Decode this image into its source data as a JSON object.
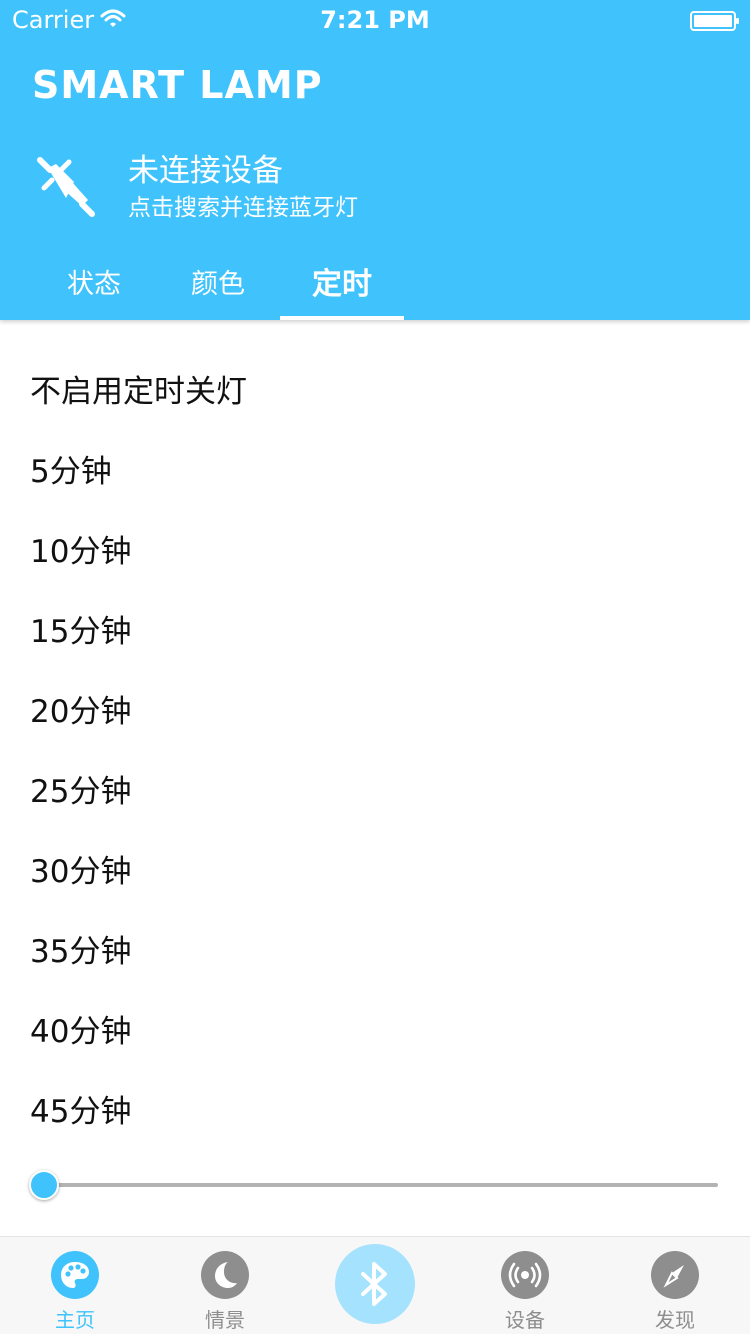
{
  "status_bar": {
    "carrier": "Carrier",
    "time": "7:21 PM",
    "wifi_icon": "wifi-icon",
    "battery_icon": "battery-icon"
  },
  "header": {
    "title": "SMART LAMP",
    "device_icon": "plug-icon",
    "connection_title": "未连接设备",
    "connection_subtitle": "点击搜索并连接蓝牙灯"
  },
  "tabs": [
    {
      "label": "状态",
      "active": false
    },
    {
      "label": "颜色",
      "active": false
    },
    {
      "label": "定时",
      "active": true
    }
  ],
  "timer_options": [
    "不启用定时关灯",
    "5分钟",
    "10分钟",
    "15分钟",
    "20分钟",
    "25分钟",
    "30分钟",
    "35分钟",
    "40分钟",
    "45分钟"
  ],
  "slider": {
    "value_fraction": 0.0
  },
  "bottom_nav": {
    "items": [
      {
        "label": "主页",
        "icon": "palette-icon",
        "active": true
      },
      {
        "label": "情景",
        "icon": "moon-icon",
        "active": false
      },
      {
        "label": "",
        "icon": "bluetooth-icon",
        "active": false
      },
      {
        "label": "设备",
        "icon": "broadcast-icon",
        "active": false
      },
      {
        "label": "发现",
        "icon": "compass-icon",
        "active": false
      }
    ]
  },
  "colors": {
    "accent": "#40C3FC",
    "bluetooth_button": "#A4E2FD",
    "inactive_icon": "#8E8E8E"
  }
}
